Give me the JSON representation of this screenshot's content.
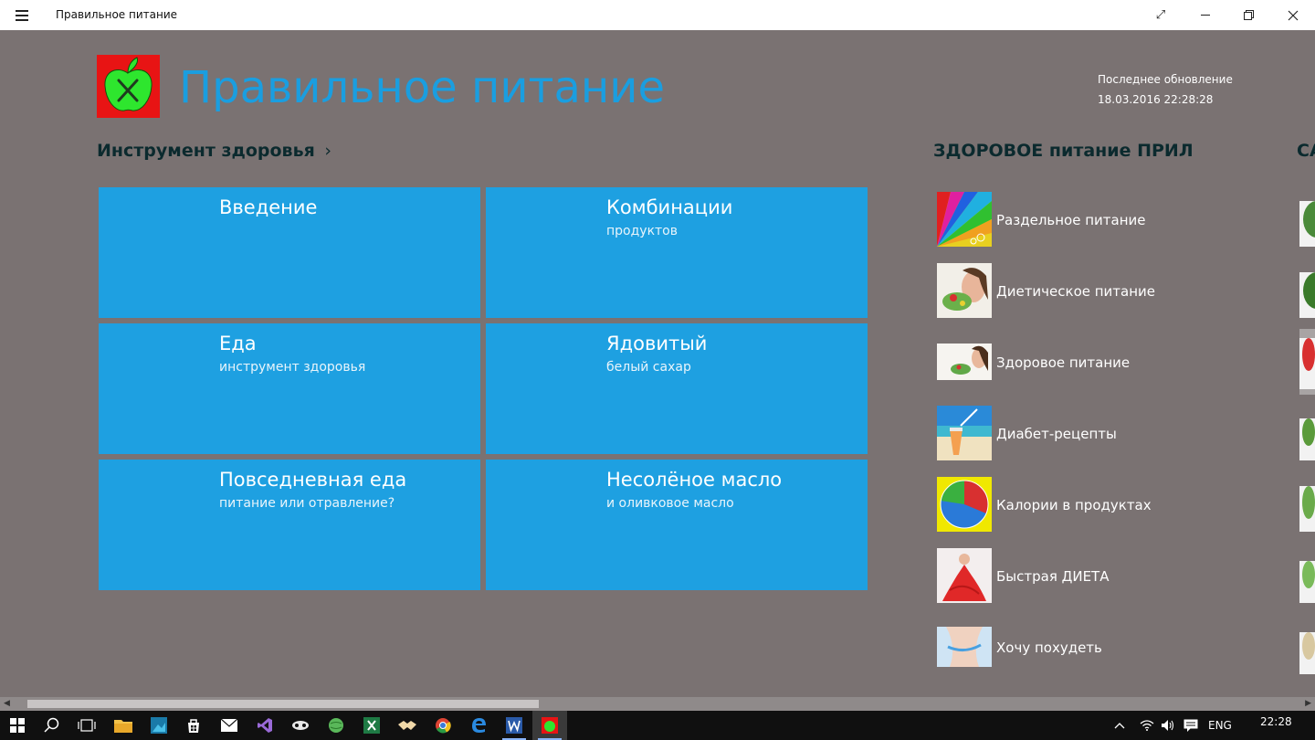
{
  "window": {
    "title": "Правильное питание",
    "controls": [
      "fullscreen-icon",
      "minimize-icon",
      "restore-icon",
      "close-icon"
    ]
  },
  "header": {
    "app_title": "Правильное питание",
    "update_label": "Последнее обновление",
    "update_value": "18.03.2016 22:28:28"
  },
  "section1": {
    "heading": "Инструмент здоровья",
    "chevron": "›",
    "tiles": [
      {
        "title": "Введение",
        "subtitle": ""
      },
      {
        "title": "Комбинации",
        "subtitle": "продуктов"
      },
      {
        "title": "Еда",
        "subtitle": "инструмент здоровья"
      },
      {
        "title": "Ядовитый",
        "subtitle": "белый сахар"
      },
      {
        "title": "Повседневная еда",
        "subtitle": "питание или отравление?"
      },
      {
        "title": "Несолёное масло",
        "subtitle": "и оливковое масло"
      }
    ]
  },
  "section2": {
    "heading": "ЗДОРОВОЕ питание ПРИЛ",
    "items": [
      {
        "label": "Раздельное питание"
      },
      {
        "label": "Диетическое питание"
      },
      {
        "label": "Здоровое питание"
      },
      {
        "label": "Диабет-рецепты"
      },
      {
        "label": "Калории в продуктах"
      },
      {
        "label": "Быстрая ДИЕТА"
      },
      {
        "label": "Хочу похудеть"
      }
    ]
  },
  "section3": {
    "heading_partial": "СА"
  },
  "taskbar": {
    "language": "ENG",
    "time": "22:28"
  },
  "colors": {
    "background": "#7a7272",
    "tile": "#1ea0e1",
    "title_blue": "#1a9ee0",
    "logo_red": "#e81414",
    "logo_green": "#2ee62e",
    "heading": "#0b2a2e"
  }
}
